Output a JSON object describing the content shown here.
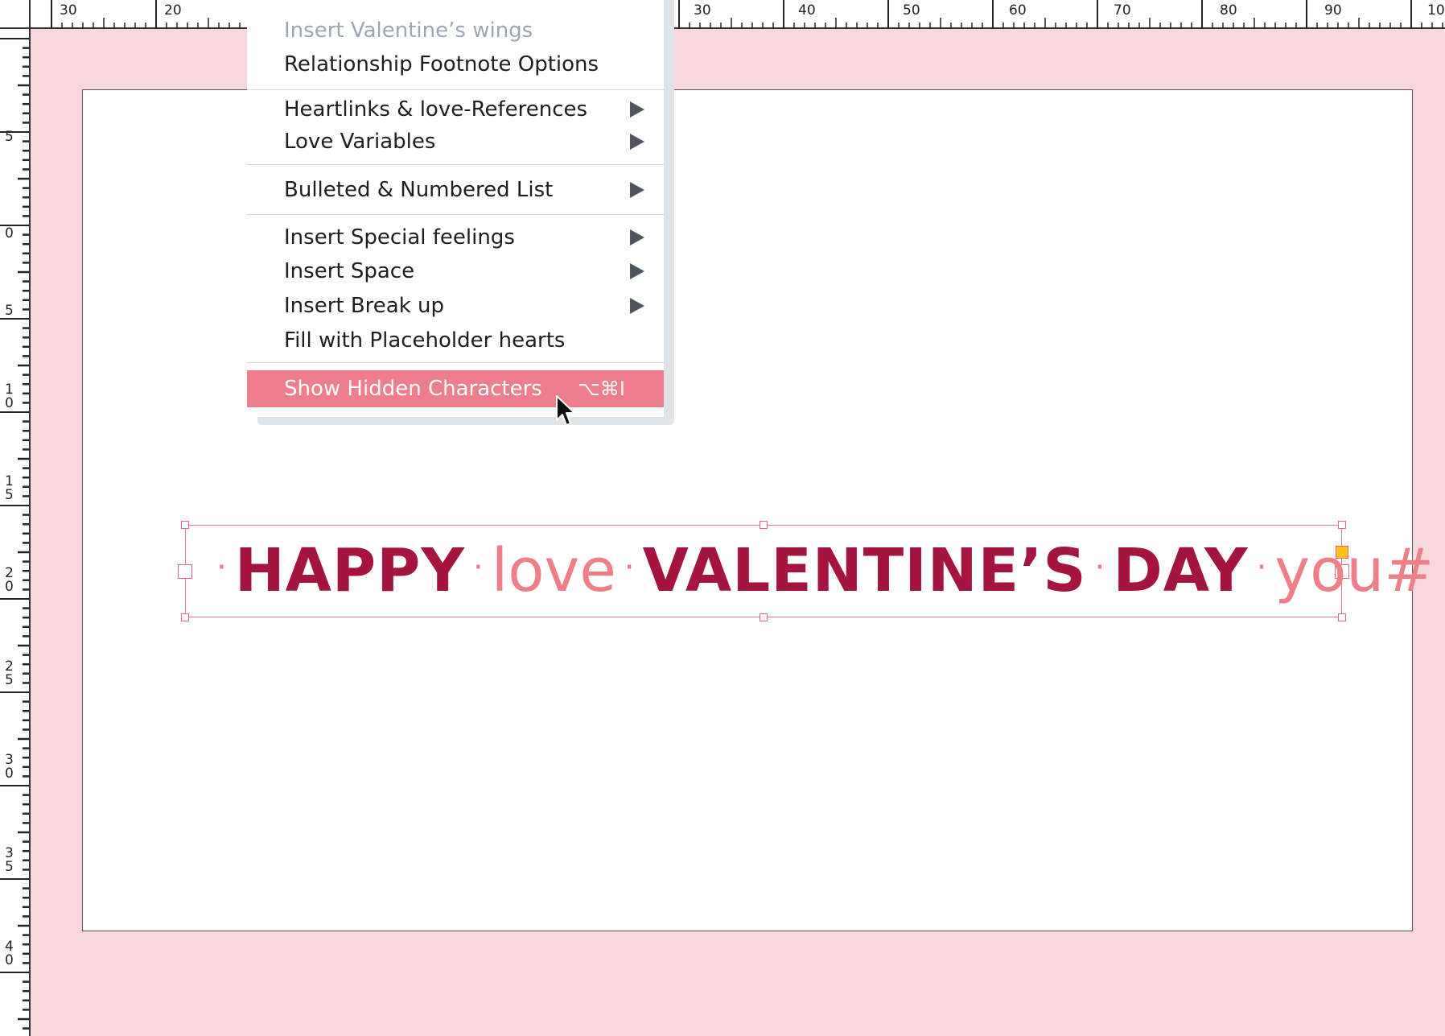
{
  "rulers": {
    "top_labels": [
      "30",
      "20",
      "30",
      "40",
      "50",
      "60",
      "70",
      "80",
      "90",
      "10"
    ],
    "left_labels": [
      "5",
      "0",
      "5",
      "1 0",
      "1 5",
      "2 0",
      "2 5",
      "3 0",
      "3 5",
      "4 0"
    ]
  },
  "context_menu": {
    "items": [
      {
        "label": "Insert Valentine’s wings",
        "disabled": true
      },
      {
        "label": "Relationship Footnote Options"
      },
      {
        "label": "Heartlinks & love-References",
        "submenu": true
      },
      {
        "label": "Love Variables",
        "submenu": true
      },
      {
        "label": "Bulleted & Numbered List",
        "submenu": true
      },
      {
        "label": "Insert Special feelings",
        "submenu": true
      },
      {
        "label": "Insert Space",
        "submenu": true
      },
      {
        "label": "Insert Break up",
        "submenu": true
      },
      {
        "label": "Fill with Placeholder hearts"
      },
      {
        "label": "Show Hidden Characters",
        "shortcut": "⌥⌘I",
        "highlighted": true
      }
    ]
  },
  "text_frame": {
    "words": [
      "HAPPY",
      "love",
      "VALENTINE’S",
      "DAY",
      "you#"
    ],
    "cursor_char": "|",
    "separator": "·"
  },
  "colors": {
    "pasteboard": "#f9d7dd",
    "bold_text": "#a5133f",
    "light_text": "#ee7f89",
    "menu_highlight": "#ee7e8d",
    "frame_border": "#e87c86",
    "overflow_port": "#f7c21c"
  },
  "icons": {
    "submenu": "submenu-arrow-icon",
    "pointer": "mouse-pointer-icon"
  }
}
